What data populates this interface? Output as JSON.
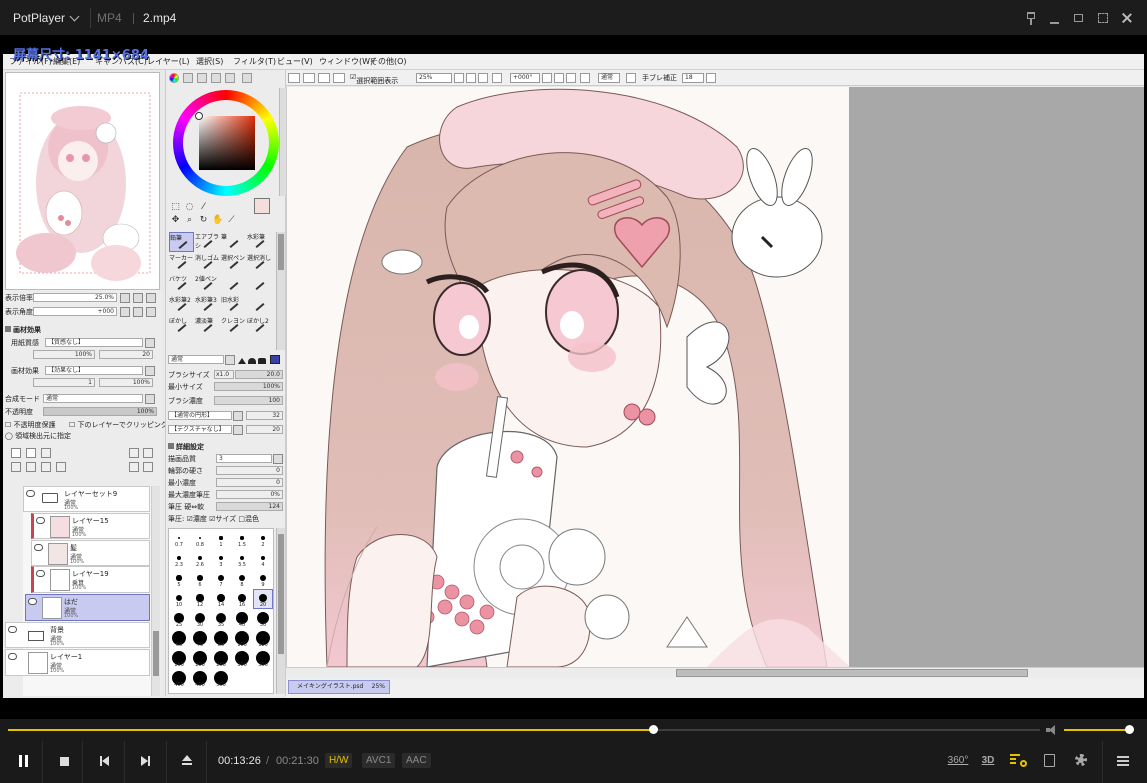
{
  "titlebar": {
    "app_name": "PotPlayer",
    "format": "MP4",
    "file_name": "2.mp4"
  },
  "osd": {
    "text": "屏幕尺寸: 1141×684"
  },
  "sai": {
    "menu": [
      "ファイル(F)",
      "編集(E)",
      "キャンバス(C)",
      "レイヤー(L)",
      "選択(S)",
      "フィルタ(T)",
      "ビュー(V)",
      "ウィンドウ(W)",
      "その他(O)"
    ],
    "toolbar": {
      "selection_visible": "選択範囲表示",
      "zoom": "25%",
      "angle": "+000°",
      "blend": "通常",
      "stabilizer_label": "手ブレ補正",
      "stabilizer_value": "18"
    },
    "navigator": {
      "zoom_label": "表示倍率",
      "zoom_value": "25.0%",
      "angle_label": "表示角度",
      "angle_value": "+000",
      "texture_header": "画材効果",
      "paper_label": "用紙質感",
      "paper_value": "【質感なし】",
      "paper_pct": "100%",
      "paper_strength": "20",
      "brush_label": "画材効果",
      "brush_value": "【効果なし】",
      "brush_num": "1",
      "brush_pct": "100%",
      "blend_label": "合成モード",
      "blend_value": "通常",
      "opacity_label": "不透明度",
      "opacity_value": "100%",
      "preserve_opacity": "不透明度保護",
      "clip_below": "下のレイヤーでクリッピング",
      "selection_source": "領域検出元に指定"
    },
    "layers": [
      {
        "name": "レイヤーセット9",
        "mode": "通常",
        "opacity": "100%"
      },
      {
        "name": "レイヤー15",
        "mode": "通常",
        "opacity": "100%"
      },
      {
        "name": "髪",
        "mode": "通常",
        "opacity": "100%"
      },
      {
        "name": "レイヤー19",
        "mode": "乗算",
        "opacity": "100%"
      },
      {
        "name": "はだ",
        "mode": "通常",
        "opacity": "100%"
      },
      {
        "name": "背景",
        "mode": "通常",
        "opacity": "100%"
      },
      {
        "name": "レイヤー1",
        "mode": "通常",
        "opacity": "100%"
      }
    ],
    "brushes": [
      "鉛筆",
      "エアブラシ",
      "筆",
      "水彩筆",
      "マーカー",
      "消しゴム",
      "選択ペン",
      "選択消し",
      "バケツ",
      "2値ペン",
      "",
      "",
      "水彩筆2",
      "水彩筆3",
      "旧水彩",
      "",
      "ぼかし",
      "濃淡筆",
      "クレヨン",
      "ぼかし2"
    ],
    "brush_settings": {
      "mode": "通常",
      "size_label": "ブラシサイズ",
      "size_mult": "x1.0",
      "size_value": "20.0",
      "min_size_label": "最小サイズ",
      "min_size_value": "100%",
      "density_label": "ブラシ濃度",
      "density_value": "100",
      "shape": "【通常の円形】",
      "shape_value": "32",
      "texture": "【テクスチャなし】",
      "texture_value": "20",
      "detail_header": "詳細設定",
      "quality_label": "描画品質",
      "quality_value": "3",
      "edge_label": "輪郭の硬さ",
      "edge_value": "0",
      "min_density_label": "最小濃度",
      "min_density_value": "0",
      "max_pressure_label": "最大濃度筆圧",
      "max_pressure_value": "0%",
      "pressure_label": "筆圧 硬⇔軟",
      "pressure_value": "124",
      "pressure_opts": "筆圧: ☑濃度 ☑サイズ □混色"
    },
    "dot_sizes": [
      [
        "0.7",
        "0.8",
        "1",
        "1.5",
        "2"
      ],
      [
        "2.3",
        "2.6",
        "3",
        "3.5",
        "4"
      ],
      [
        "5",
        "6",
        "7",
        "8",
        "9"
      ],
      [
        "10",
        "12",
        "14",
        "16",
        "20"
      ],
      [
        "25",
        "30",
        "35",
        "40",
        "50"
      ],
      [
        "60",
        "70",
        "80",
        "100",
        "120"
      ],
      [
        "160",
        "200",
        "250",
        "300",
        "350"
      ],
      [
        "400",
        "450",
        "500",
        "",
        ""
      ]
    ],
    "doc_tab": "メイキングイラスト.psd",
    "doc_zoom": "25%"
  },
  "player": {
    "time_current": "00:13:26",
    "time_total": "00:21:30",
    "progress": 0.625,
    "volume": 0.95,
    "badges": {
      "hw": "H/W",
      "video": "AVC1",
      "audio": "AAC"
    },
    "btn_360": "360°",
    "btn_3d": "3D",
    "accent": "#e5c100"
  }
}
